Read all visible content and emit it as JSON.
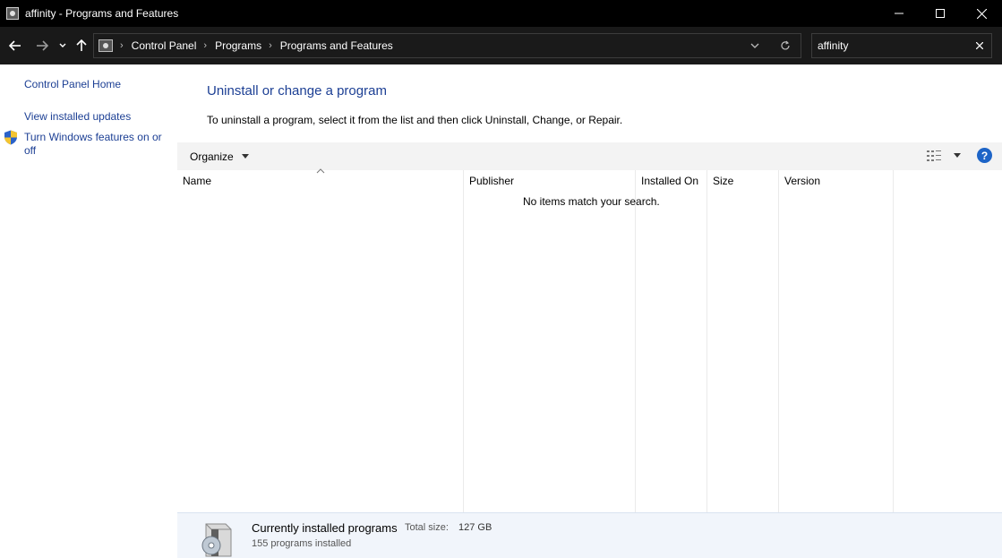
{
  "window": {
    "title": "affinity - Programs and Features"
  },
  "address_bar": {
    "breadcrumbs": [
      "Control Panel",
      "Programs",
      "Programs and Features"
    ]
  },
  "search": {
    "value": "affinity"
  },
  "left_pane": {
    "links": [
      "Control Panel Home",
      "View installed updates",
      "Turn Windows features on or off"
    ]
  },
  "main": {
    "title": "Uninstall or change a program",
    "description": "To uninstall a program, select it from the list and then click Uninstall, Change, or Repair."
  },
  "toolbar": {
    "organize_label": "Organize"
  },
  "columns": [
    "Name",
    "Publisher",
    "Installed On",
    "Size",
    "Version"
  ],
  "list": {
    "empty_message": "No items match your search."
  },
  "details": {
    "title": "Currently installed programs",
    "total_size_label": "Total size:",
    "total_size_value": "127 GB",
    "count_text": "155 programs installed"
  },
  "colors": {
    "link_blue": "#1c3f94",
    "title_bar": "#000000",
    "address_bar_bg": "#191919",
    "help_blue": "#1d64c7"
  }
}
